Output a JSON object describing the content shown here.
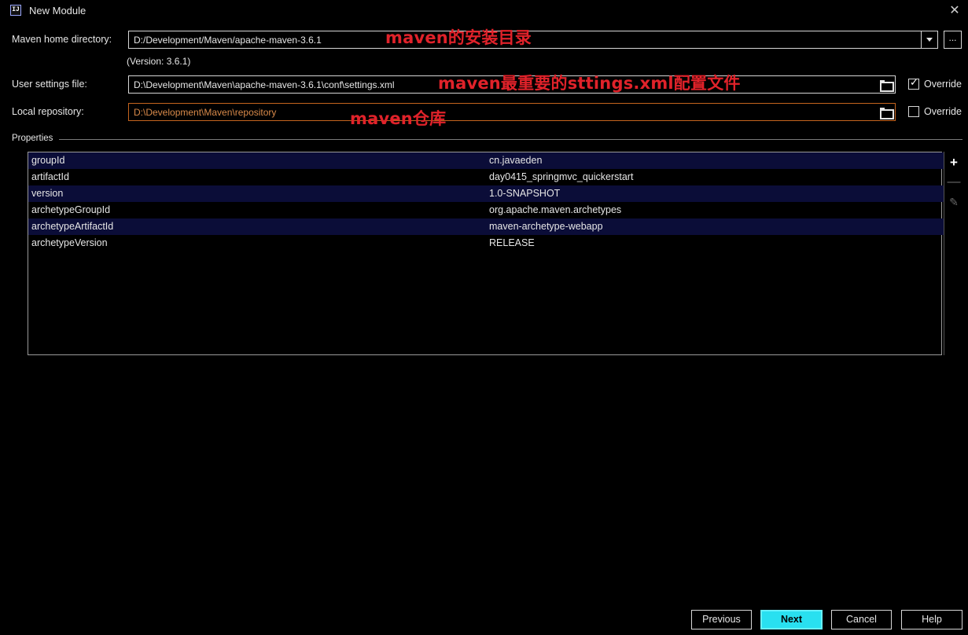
{
  "window": {
    "title": "New Module",
    "app_icon_text": "IJ"
  },
  "form": {
    "maven_home": {
      "label": "Maven home directory:",
      "value": "D:/Development/Maven/apache-maven-3.6.1",
      "browse_label": "...",
      "version_note": "(Version: 3.6.1)"
    },
    "user_settings": {
      "label": "User settings file:",
      "value": "D:\\Development\\Maven\\apache-maven-3.6.1\\conf\\settings.xml",
      "override_label": "Override",
      "override_checked": true
    },
    "local_repo": {
      "label": "Local repository:",
      "value": "D:\\Development\\Maven\\repository",
      "override_label": "Override",
      "override_checked": false
    }
  },
  "annotations": {
    "maven_home": "maven的安装目录",
    "user_settings": "maven最重要的sttings.xml配置文件",
    "local_repo": "maven仓库"
  },
  "properties": {
    "title": "Properties",
    "rows": [
      {
        "key": "groupId",
        "value": "cn.javaeden"
      },
      {
        "key": "artifactId",
        "value": "day0415_springmvc_quickerstart"
      },
      {
        "key": "version",
        "value": "1.0-SNAPSHOT"
      },
      {
        "key": "archetypeGroupId",
        "value": "org.apache.maven.archetypes"
      },
      {
        "key": "archetypeArtifactId",
        "value": "maven-archetype-webapp"
      },
      {
        "key": "archetypeVersion",
        "value": "RELEASE"
      }
    ]
  },
  "buttons": {
    "previous": "Previous",
    "next": "Next",
    "cancel": "Cancel",
    "help": "Help"
  },
  "colors": {
    "annotation": "#e0222a",
    "primary_button": "#29e0f0",
    "selected_row": "#0b0d38",
    "repo_path": "#d98a4a"
  }
}
